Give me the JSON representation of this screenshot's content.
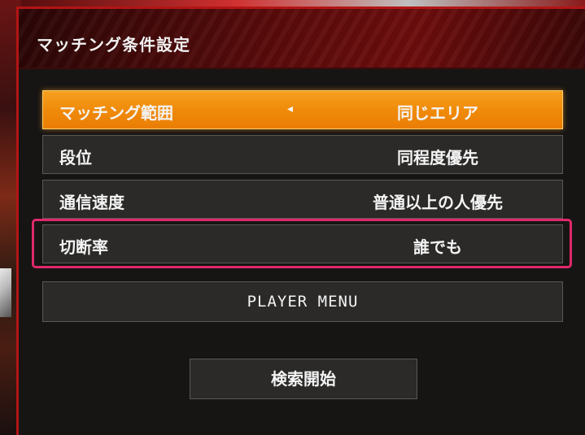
{
  "header": {
    "title": "マッチング条件設定"
  },
  "settings": [
    {
      "label": "マッチング範囲",
      "value": "同じエリア",
      "selected": true
    },
    {
      "label": "段位",
      "value": "同程度優先"
    },
    {
      "label": "通信速度",
      "value": "普通以上の人優先"
    },
    {
      "label": "切断率",
      "value": "誰でも"
    }
  ],
  "icons": {
    "left_arrow": "◂"
  },
  "buttons": {
    "player_menu": "PLAYER MENU",
    "search_start": "検索開始"
  },
  "colors": {
    "selected_row": "#f08b0a",
    "focus_outline": "#e0286a",
    "header_red": "#5a0b0b",
    "panel_border": "#b21515"
  }
}
